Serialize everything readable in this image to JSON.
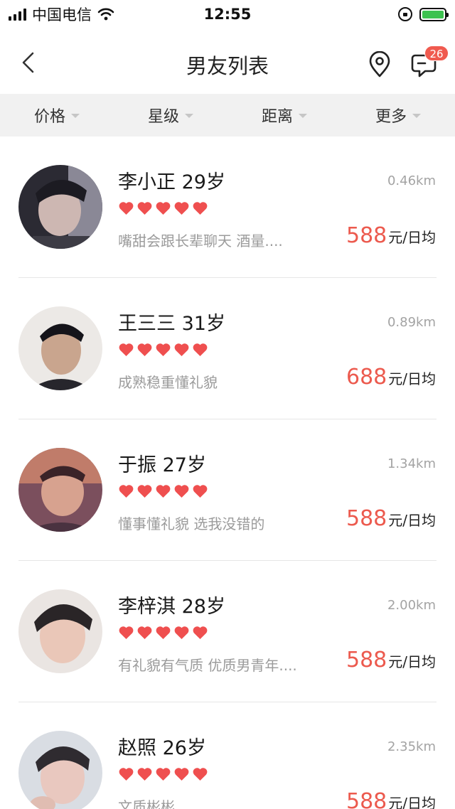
{
  "status_bar": {
    "carrier": "中国电信",
    "time": "12:55",
    "battery_color": "#3cc24f"
  },
  "nav": {
    "title": "男友列表",
    "back_icon": "chevron-left-icon",
    "location_icon": "location-pin-icon",
    "message_icon": "chat-bubble-icon",
    "message_badge": "26"
  },
  "filters": [
    {
      "label": "价格"
    },
    {
      "label": "星级"
    },
    {
      "label": "距离"
    },
    {
      "label": "更多"
    }
  ],
  "colors": {
    "accent": "#ec5a4e",
    "heart": "#ef4f4f",
    "badge": "#f05a4f"
  },
  "profiles": [
    {
      "name": "李小正 29岁",
      "distance": "0.46km",
      "rating": 5,
      "description": "嘴甜会跟长辈聊天 酒量....",
      "price": "588",
      "unit": "元/日均"
    },
    {
      "name": "王三三 31岁",
      "distance": "0.89km",
      "rating": 5,
      "description": "成熟稳重懂礼貌",
      "price": "688",
      "unit": "元/日均"
    },
    {
      "name": "于振 27岁",
      "distance": "1.34km",
      "rating": 5,
      "description": "懂事懂礼貌 选我没错的",
      "price": "588",
      "unit": "元/日均"
    },
    {
      "name": "李梓淇 28岁",
      "distance": "2.00km",
      "rating": 5,
      "description": "有礼貌有气质 优质男青年....",
      "price": "588",
      "unit": "元/日均"
    },
    {
      "name": "赵照 26岁",
      "distance": "2.35km",
      "rating": 5,
      "description": "文质彬彬",
      "price": "588",
      "unit": "元/日均"
    }
  ]
}
